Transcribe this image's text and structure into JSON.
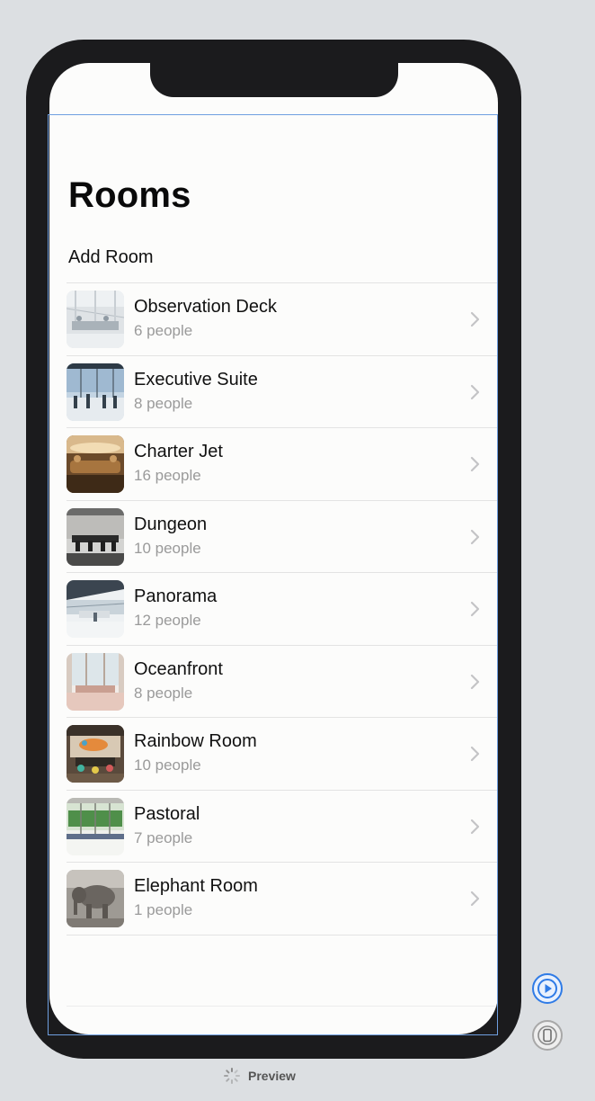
{
  "screen": {
    "title": "Rooms",
    "add_room_label": "Add Room"
  },
  "rooms": [
    {
      "name": "Observation Deck",
      "capacity": "6 people",
      "thumb": "observation-deck-photo"
    },
    {
      "name": "Executive Suite",
      "capacity": "8 people",
      "thumb": "executive-suite-photo"
    },
    {
      "name": "Charter Jet",
      "capacity": "16 people",
      "thumb": "charter-jet-photo"
    },
    {
      "name": "Dungeon",
      "capacity": "10 people",
      "thumb": "dungeon-photo"
    },
    {
      "name": "Panorama",
      "capacity": "12 people",
      "thumb": "panorama-photo"
    },
    {
      "name": "Oceanfront",
      "capacity": "8 people",
      "thumb": "oceanfront-photo"
    },
    {
      "name": "Rainbow Room",
      "capacity": "10 people",
      "thumb": "rainbow-room-photo"
    },
    {
      "name": "Pastoral",
      "capacity": "7 people",
      "thumb": "pastoral-photo"
    },
    {
      "name": "Elephant Room",
      "capacity": "1 people",
      "thumb": "elephant-room-photo"
    }
  ],
  "canvas": {
    "preview_label": "Preview",
    "play_icon": "play-circle-icon",
    "device_icon": "device-icon"
  },
  "colors": {
    "device_frame": "#1b1b1d",
    "screen_bg": "#fcfcfb",
    "secondary_text": "#9a9a9a",
    "accent": "#2f7be6"
  }
}
